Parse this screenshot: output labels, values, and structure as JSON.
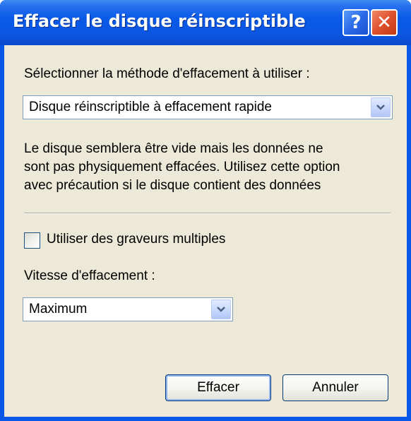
{
  "window": {
    "title": "Effacer le disque réinscriptible",
    "help_label": "?",
    "close_label": "✕"
  },
  "dialog": {
    "method_label": "Sélectionner la méthode d'effacement à utiliser :",
    "method_selected": "Disque réinscriptible à effacement rapide",
    "description_lines": [
      "Le disque semblera être vide mais les données ne",
      "sont pas physiquement effacées. Utilisez cette option",
      "avec précaution si le disque contient des données"
    ],
    "multiple_burners_label": "Utiliser des graveurs multiples",
    "multiple_burners_checked": false,
    "speed_label": "Vitesse d'effacement :",
    "speed_selected": "Maximum"
  },
  "buttons": {
    "erase_label": "Effacer",
    "cancel_label": "Annuler"
  },
  "colors": {
    "titlebar": "#0a56e8",
    "client_background": "#ece9d8",
    "close_button": "#e0502c",
    "combo_border": "#7f9db9"
  }
}
